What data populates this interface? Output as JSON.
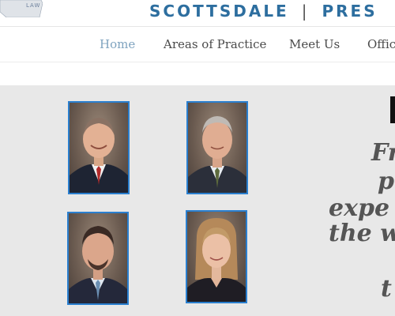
{
  "header": {
    "logo_text": "LAW",
    "brand_left": "SCOTTSDALE",
    "brand_sep": "|",
    "brand_right": "PRES"
  },
  "nav": {
    "items": [
      {
        "label": "Home",
        "active": true
      },
      {
        "label": "Areas of Practice",
        "active": false
      },
      {
        "label": "Meet Us",
        "active": false
      },
      {
        "label": "Office",
        "active": false
      }
    ]
  },
  "main": {
    "tagline_lines": [
      "Fr",
      "p",
      "expe",
      "the w",
      "t"
    ]
  },
  "colors": {
    "brand": "#2d6e9f",
    "nav_active": "#7fa3bf",
    "photo_border": "#2a7fcf",
    "content_bg": "#e8e8e8"
  }
}
